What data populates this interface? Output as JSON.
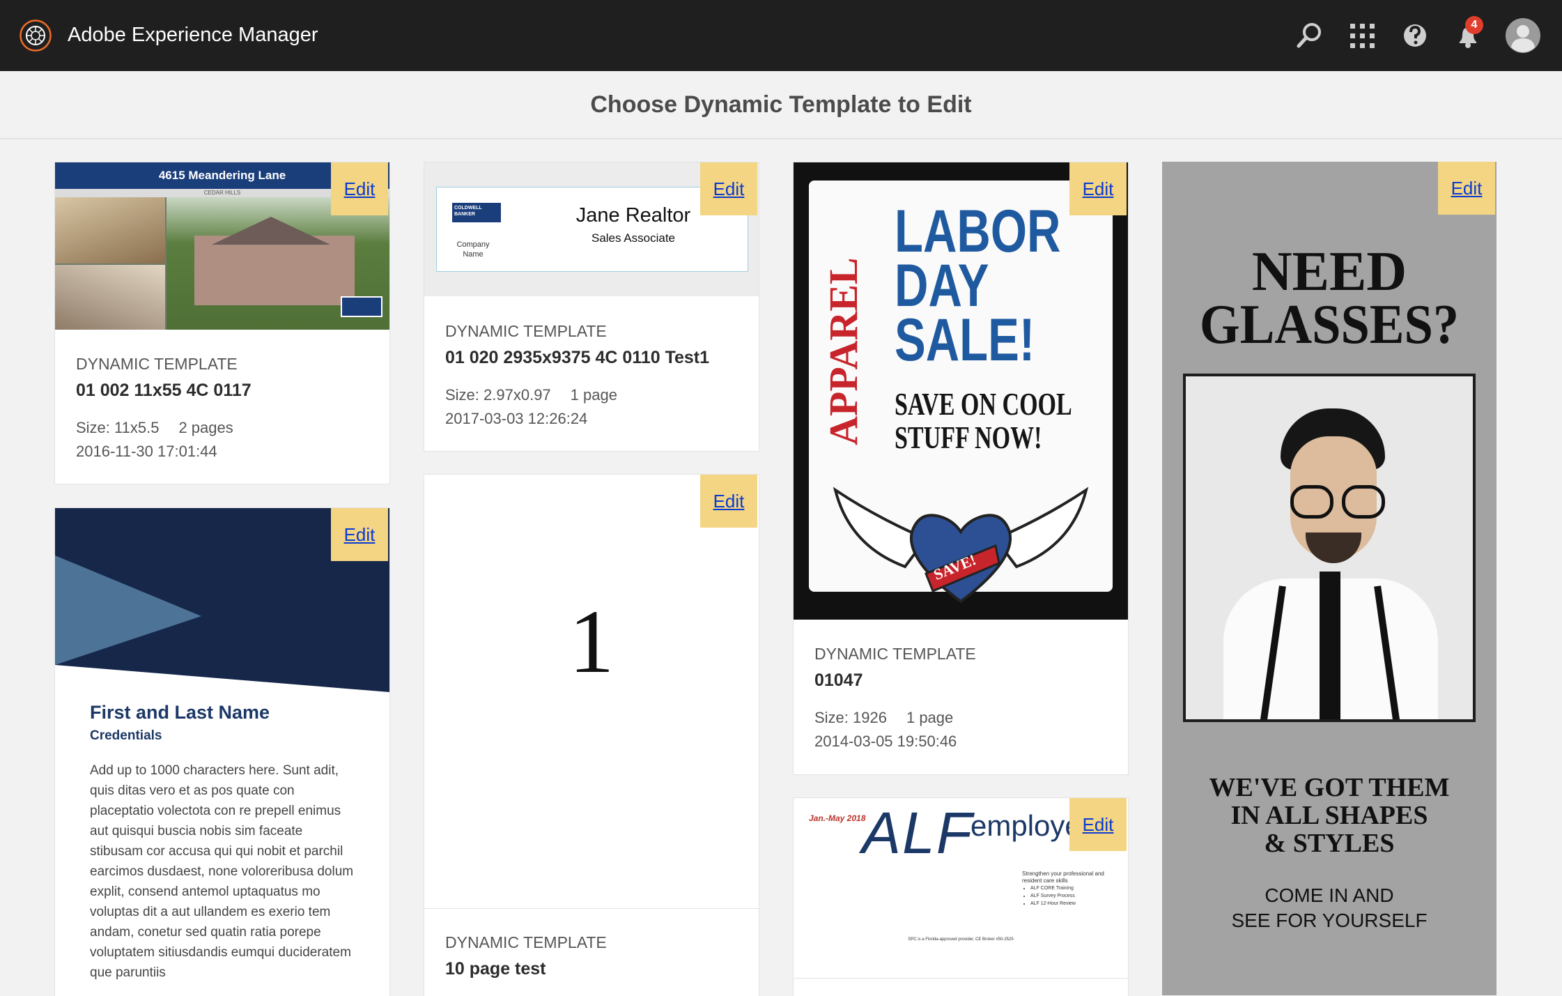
{
  "app": {
    "title": "Adobe Experience Manager",
    "notification_count": "4"
  },
  "header": {
    "title": "Choose Dynamic Template to Edit"
  },
  "cards": [
    {
      "thumb_banner": "4615 Meandering Lane",
      "thumb_sub": "CEDAR HILLS",
      "edit_label": "Edit",
      "type": "DYNAMIC TEMPLATE",
      "name": "01 002 11x55 4C 0117",
      "size": "Size: 11x5.5",
      "pages": "2 pages",
      "date": "2016-11-30 17:01:44"
    },
    {
      "thumb_name": "Jane Realtor",
      "thumb_role": "Sales Associate",
      "thumb_company": "Company",
      "thumb_company2": "Name",
      "thumb_brand": "COLDWELL BANKER",
      "edit_label": "Edit",
      "type": "DYNAMIC TEMPLATE",
      "name": "01 020 2935x9375 4C 0110 Test1",
      "size": "Size: 2.97x0.97",
      "pages": "1 page",
      "date": "2017-03-03 12:26:24"
    },
    {
      "thumb_vertical": "APPAREL",
      "thumb_l1": "LABOR",
      "thumb_l2": "DAY",
      "thumb_l3": "SALE!",
      "thumb_s1": "SAVE ON COOL",
      "thumb_s2": "STUFF NOW!",
      "thumb_ribbon": "SAVE!",
      "edit_label": "Edit",
      "type": "DYNAMIC TEMPLATE",
      "name": "01047",
      "size": "Size: 1926",
      "pages": "1 page",
      "date": "2014-03-05 19:50:46"
    },
    {
      "thumb_h1": "NEED",
      "thumb_h2": "GLASSES?",
      "thumb_b1": "WE'VE GOT THEM",
      "thumb_b2": "IN ALL SHAPES",
      "thumb_b3": "& STYLES",
      "thumb_c1": "COME IN AND",
      "thumb_c2": "SEE FOR YOURSELF",
      "edit_label": "Edit"
    },
    {
      "thumb_name": "First and Last Name",
      "thumb_credentials": "Credentials",
      "thumb_body": "Add up to 1000 characters here. Sunt adit, quis ditas vero et as pos quate con placeptatio volectota con re prepell enimus aut quisqui buscia nobis sim faceate stibusam cor accusa qui qui nobit et parchil earcimos dusdaest, none voloreribusa dolum explit, consend antemol uptaquatus mo voluptas dit a aut ullandem es exerio tem andam, conetur sed quatin ratia porepe voluptatem sitiusdandis eumqui ducideratem que paruntiis",
      "edit_label": "Edit"
    },
    {
      "thumb_number": "1",
      "edit_label": "Edit",
      "type": "DYNAMIC TEMPLATE",
      "name": "10 page test"
    },
    {
      "thumb_date": "Jan.-May 2018",
      "thumb_alf": "ALF",
      "thumb_emp": "employee",
      "thumb_lead": "Strengthen your professional and resident care skills",
      "thumb_items": [
        "ALF CORE Training",
        "ALF Survey Process",
        "ALF 12-Hour Review"
      ],
      "thumb_footer": "SPC is a Florida-approved provider, CE Broker #50-2525",
      "edit_label": "Edit"
    }
  ]
}
